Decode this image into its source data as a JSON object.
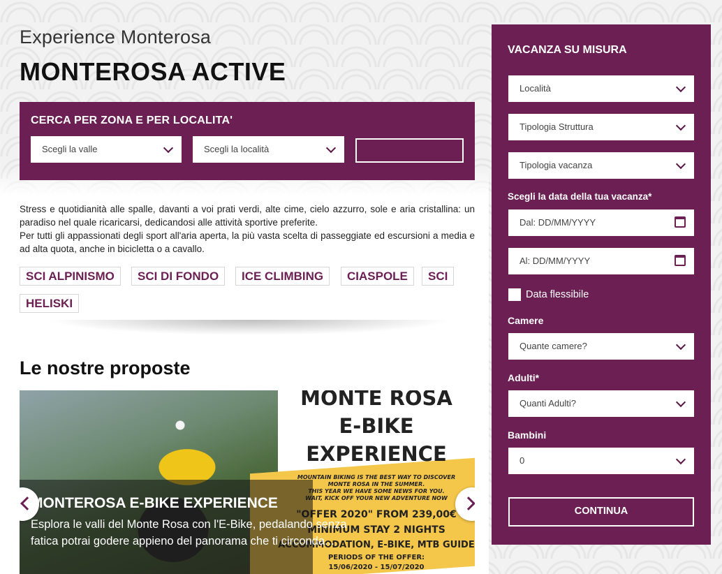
{
  "header": {
    "subtitle": "Experience Monterosa",
    "title": "MONTEROSA ACTIVE"
  },
  "search": {
    "heading": "CERCA PER ZONA E PER LOCALITA'",
    "valley_select": "Scegli la valle",
    "location_select": "Scegli la località",
    "button_label": ""
  },
  "description": {
    "p1": "Stress e quotidianità alle spalle, davanti a voi prati verdi, alte cime, cielo azzurro, sole e aria cristallina: un paradiso nel quale ricaricarsi, dedicandosi alle attività sportive preferite.",
    "p2": "Per tutti gli appassionati degli sport all'aria aperta, la più vasta scelta di passeggiate ed escursioni a media e ad alta quota, anche in bicicletta o a cavallo."
  },
  "tags": [
    "SCI ALPINISMO",
    "SCI DI FONDO",
    "ICE CLIMBING",
    "CIASPOLE",
    "SCI",
    "HELISKI"
  ],
  "proposals": {
    "title": "Le nostre proposte",
    "slide": {
      "title": "MONTEROSA E-BIKE EXPERIENCE",
      "text": "Esplora le valli del Monte Rosa con l'E-Bike, pedalando senza fatica potrai godere appieno del panorama che ti circonda...",
      "poster_lines": [
        "MONTE ROSA",
        "E-BIKE",
        "EXPERIENCE"
      ],
      "poster_small": [
        "MOUNTAIN BIKING IS THE BEST WAY TO DISCOVER",
        "MONTE ROSA IN THE SUMMER.",
        "THIS YEAR WE HAVE SOME NEWS FOR YOU.",
        "WAIT, KICK OFF YOUR NEW ADVENTURE NOW"
      ],
      "poster_offer": "\"OFFER 2020\" FROM 239,00€",
      "poster_stay": "MINIMUM STAY 2 NIGHTS",
      "poster_incl": "ACCOMMODATION, E-BIKE, MTB GUIDE",
      "poster_period": "PERIODS OF THE OFFER:",
      "poster_dates": "15/06/2020 - 15/07/2020"
    }
  },
  "panel": {
    "title": "VACANZA SU MISURA",
    "localita": "Località",
    "tipologia_struttura": "Tipologia Struttura",
    "tipologia_vacanza": "Tipologia vacanza",
    "date_label": "Scegli la data della tua vacanza*",
    "date_from": "Dal: DD/MM/YYYY",
    "date_to": "Al: DD/MM/YYYY",
    "flexible": "Data flessibile",
    "rooms_label": "Camere",
    "rooms": "Quante camere?",
    "adults_label": "Adulti*",
    "adults": "Quanti Adulti?",
    "children_label": "Bambini",
    "children": "0",
    "continue": "CONTINUA"
  },
  "colors": {
    "brand": "#6b1f53",
    "poster_yellow": "#f4c64a"
  }
}
